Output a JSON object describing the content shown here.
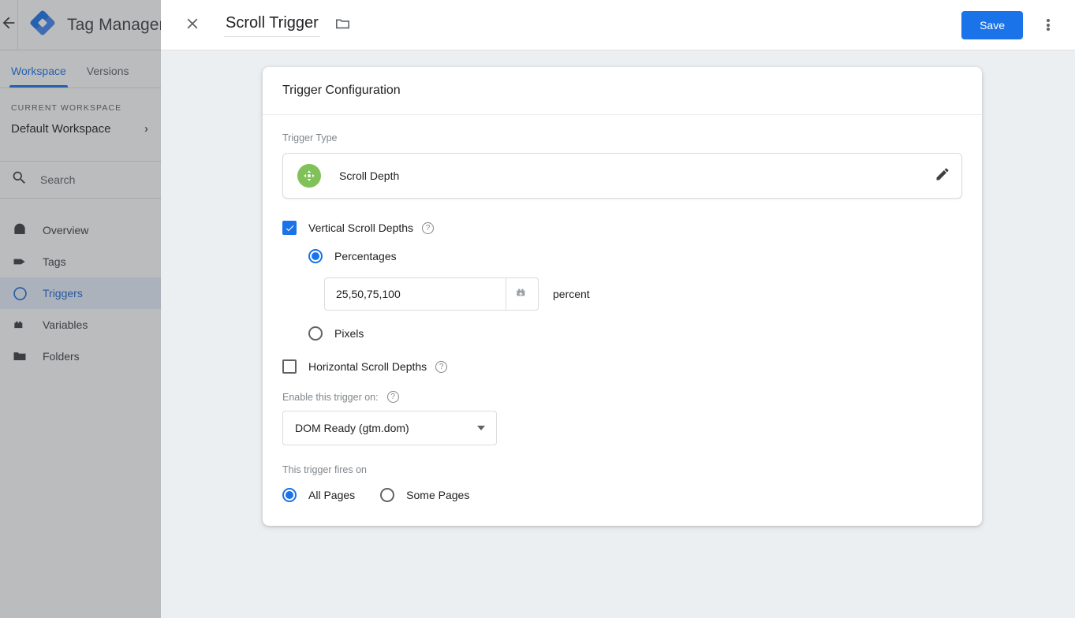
{
  "app": {
    "back_icon": "back-arrow-icon",
    "logo_icon": "tag-manager-logo",
    "brand_title": "Tag Manager",
    "tabs": [
      {
        "label": "Workspace",
        "active": true
      },
      {
        "label": "Versions",
        "active": false
      }
    ],
    "workspace": {
      "caption": "CURRENT WORKSPACE",
      "name": "Default Workspace",
      "chevron": "›"
    },
    "search": {
      "placeholder": "Search",
      "icon": "search-icon"
    },
    "nav": [
      {
        "label": "Overview",
        "icon": "overview-icon",
        "active": false
      },
      {
        "label": "Tags",
        "icon": "tag-icon",
        "active": false
      },
      {
        "label": "Triggers",
        "icon": "trigger-icon",
        "active": true
      },
      {
        "label": "Variables",
        "icon": "variable-icon",
        "active": false
      },
      {
        "label": "Folders",
        "icon": "folder-icon",
        "active": false
      }
    ]
  },
  "modal": {
    "close_icon": "close-icon",
    "title": "Scroll Trigger",
    "folder_icon": "folder-icon",
    "save_label": "Save",
    "more_icon": "more-vertical-icon",
    "accent_color": "#1a73e8"
  },
  "card": {
    "heading": "Trigger Configuration",
    "trigger_type": {
      "label": "Trigger Type",
      "name": "Scroll Depth",
      "icon": "scroll-depth-icon",
      "icon_color": "#81c15a",
      "edit_icon": "pencil-icon"
    },
    "vertical": {
      "label": "Vertical Scroll Depths",
      "checked": true,
      "help_icon": "help-icon",
      "options": [
        {
          "label": "Percentages",
          "selected": true
        },
        {
          "label": "Pixels",
          "selected": false
        }
      ],
      "value": "25,50,75,100",
      "variable_picker_icon": "variable-picker-icon",
      "unit": "percent"
    },
    "horizontal": {
      "label": "Horizontal Scroll Depths",
      "checked": false,
      "help_icon": "help-icon"
    },
    "enable_on": {
      "label": "Enable this trigger on:",
      "help_icon": "help-icon",
      "value": "DOM Ready (gtm.dom)"
    },
    "fires_on": {
      "label": "This trigger fires on",
      "options": [
        {
          "label": "All Pages",
          "selected": true
        },
        {
          "label": "Some Pages",
          "selected": false
        }
      ]
    }
  }
}
